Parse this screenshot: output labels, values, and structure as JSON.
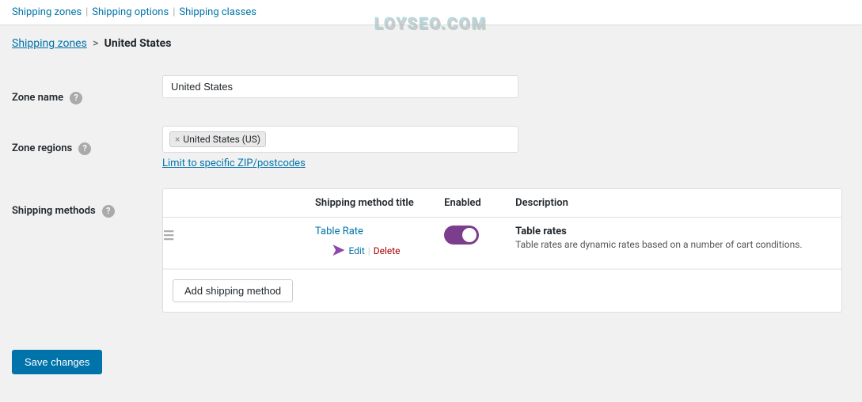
{
  "nav": {
    "shipping_zones_label": "Shipping zones",
    "separator1": "|",
    "shipping_options_label": "Shipping options",
    "separator2": "|",
    "shipping_classes_label": "Shipping classes"
  },
  "watermark": "LOYSEO.COM",
  "breadcrumb": {
    "back_link": "Shipping zones",
    "arrow": ">",
    "current": "United States"
  },
  "form": {
    "zone_name": {
      "label": "Zone name",
      "value": "United States",
      "help": "?"
    },
    "zone_regions": {
      "label": "Zone regions",
      "help": "?",
      "tag": "United States (US)",
      "tag_remove": "×",
      "zip_link": "Limit to specific ZIP/postcodes"
    },
    "shipping_methods": {
      "label": "Shipping methods",
      "help": "?",
      "table_headers": {
        "title_col": "Shipping method title",
        "enabled_col": "Enabled",
        "desc_col": "Description"
      },
      "methods": [
        {
          "drag": "≡",
          "name": "Table Rate",
          "edit": "Edit",
          "delete": "Delete",
          "enabled": true,
          "desc_title": "Table rates",
          "desc_text": "Table rates are dynamic rates based on a number of cart conditions."
        }
      ],
      "add_button": "Add shipping method"
    }
  },
  "footer": {
    "save_button": "Save changes"
  }
}
